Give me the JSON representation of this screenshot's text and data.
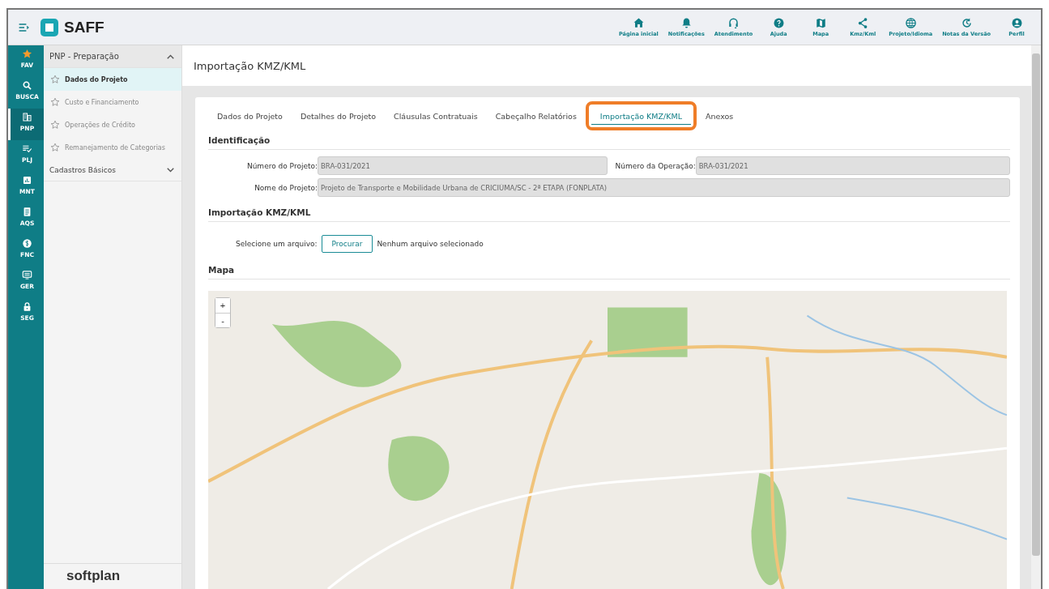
{
  "app": {
    "name": "SAFF"
  },
  "top_nav": [
    {
      "label": "Página inicial",
      "kind": "home"
    },
    {
      "label": "Notificações",
      "kind": "bell"
    },
    {
      "label": "Atendimento",
      "kind": "headset"
    },
    {
      "label": "Ajuda",
      "kind": "help"
    },
    {
      "label": "Mapa",
      "kind": "map"
    },
    {
      "label": "Kmz/Kml",
      "kind": "share"
    },
    {
      "label": "Projeto/Idioma",
      "kind": "globe"
    },
    {
      "label": "Notas da Versão",
      "kind": "history"
    },
    {
      "label": "Perfil",
      "kind": "user"
    }
  ],
  "rail": [
    {
      "label": "FAV",
      "kind": "star",
      "selected": false
    },
    {
      "label": "BUSCA",
      "kind": "search",
      "selected": false
    },
    {
      "label": "PNP",
      "kind": "building",
      "selected": true
    },
    {
      "label": "PLJ",
      "kind": "checklist",
      "selected": false
    },
    {
      "label": "MNT",
      "kind": "chart",
      "selected": false
    },
    {
      "label": "AQS",
      "kind": "doc",
      "selected": false
    },
    {
      "label": "FNC",
      "kind": "money",
      "selected": false
    },
    {
      "label": "GER",
      "kind": "monitor",
      "selected": false
    },
    {
      "label": "SEG",
      "kind": "lock",
      "selected": false
    }
  ],
  "sidebar": {
    "groups": [
      {
        "title": "PNP - Preparação",
        "expanded": true,
        "items": [
          {
            "label": "Dados do Projeto",
            "selected": true
          },
          {
            "label": "Custo e Financiamento",
            "selected": false
          },
          {
            "label": "Operações de Crédito",
            "selected": false
          },
          {
            "label": "Remanejamento de Categorias",
            "selected": false
          }
        ]
      },
      {
        "title": "Cadastros Básicos",
        "expanded": false
      }
    ],
    "footer_logo": "softplan"
  },
  "page_title": "Importação KMZ/KML",
  "tabs": [
    {
      "label": "Dados do Projeto",
      "selected": false,
      "highlighted": false
    },
    {
      "label": "Detalhes do Projeto",
      "selected": false,
      "highlighted": false
    },
    {
      "label": "Cláusulas Contratuais",
      "selected": false,
      "highlighted": false
    },
    {
      "label": "Cabeçalho Relatórios",
      "selected": false,
      "highlighted": false
    },
    {
      "label": "Importação KMZ/KML",
      "selected": true,
      "highlighted": true
    },
    {
      "label": "Anexos",
      "selected": false,
      "highlighted": false
    }
  ],
  "identificacao": {
    "title": "Identificação",
    "fields": [
      {
        "label": "Número do Projeto:",
        "value": "BRA-031/2021",
        "disabled": true
      },
      {
        "label": "Número da Operação:",
        "value": "BRA-031/2021",
        "disabled": true
      },
      {
        "label": "Nome do Projeto:",
        "value": "Projeto de Transporte e Mobilidade Urbana de CRICIÚMA/SC - 2ª ETAPA (FONPLATA)",
        "disabled": true
      }
    ]
  },
  "importacao": {
    "title": "Importação KMZ/KML",
    "label": "Selecione um arquivo:",
    "button": "Procurar",
    "file_status": "Nenhum arquivo selecionado"
  },
  "mapa": {
    "title": "Mapa",
    "zoom_in": "+",
    "zoom_out": "-"
  }
}
